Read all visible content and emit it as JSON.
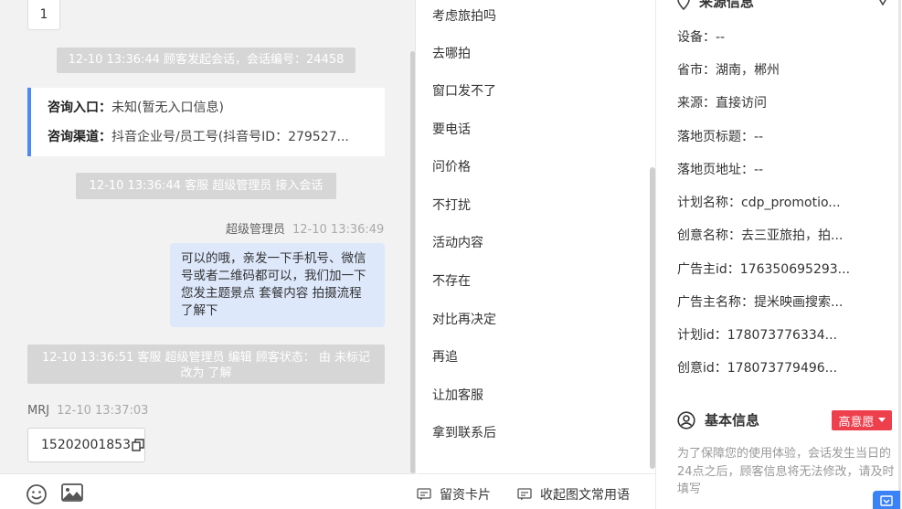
{
  "chat": {
    "top_number": "1",
    "sys_session_start": "12-10 13:36:44 顾客发起会话，会话编号：24458",
    "source_card": {
      "entry_label": "咨询入口：",
      "entry_value": "未知(暂无入口信息)",
      "channel_label": "咨询渠道：",
      "channel_value": "抖音企业号/员工号(抖音号ID：279527..."
    },
    "sys_agent_join": "12-10 13:36:44 客服 超级管理员 接入会话",
    "agent_name": "超级管理员",
    "agent_time": "12-10 13:36:49",
    "agent_message": "可以的哦，亲发一下手机号、微信号或者二维码都可以，我们加一下您发主题景点 套餐内容 拍摄流程了解下",
    "sys_status_change": "12-10 13:36:51 客服 超级管理员 编辑 顾客状态： 由 未标记 改为 了解",
    "customer_name": "MRJ",
    "customer_time": "12-10 13:37:03",
    "customer_phone": "15202001853"
  },
  "toolbar": {
    "emoji_icon": "smile-icon",
    "image_icon": "image-icon"
  },
  "phrases": {
    "items": [
      "考虑旅拍吗",
      "去哪拍",
      "窗口发不了",
      "要电话",
      "问价格",
      "不打扰",
      "活动内容",
      "不存在",
      "对比再决定",
      "再追",
      "让加客服",
      "拿到联系后"
    ],
    "footer_card": "留资卡片",
    "footer_collapse": "收起图文常用语"
  },
  "info": {
    "source_title": "来源信息",
    "rows": [
      "设备：--",
      "省市：湖南，郴州",
      "来源：直接访问",
      "落地页标题：--",
      "落地页地址：--",
      "计划名称：cdp_promotio...",
      "创意名称：去三亚旅拍，拍...",
      "广告主id：176350695293...",
      "广告主名称：提米映画搜索...",
      "计划id：178073776334...",
      "创意id：178073779496..."
    ],
    "basic_title": "基本信息",
    "intent_badge": "高意愿",
    "note": "为了保障您的使用体验，会话发生当日的24点之后，顾客信息将无法修改，请及时填写"
  },
  "colors": {
    "accent_blue": "#4b8af5",
    "bubble_blue": "#dde8fb",
    "badge_red": "#ee3f4d",
    "system_gray": "#d6d6d6"
  }
}
